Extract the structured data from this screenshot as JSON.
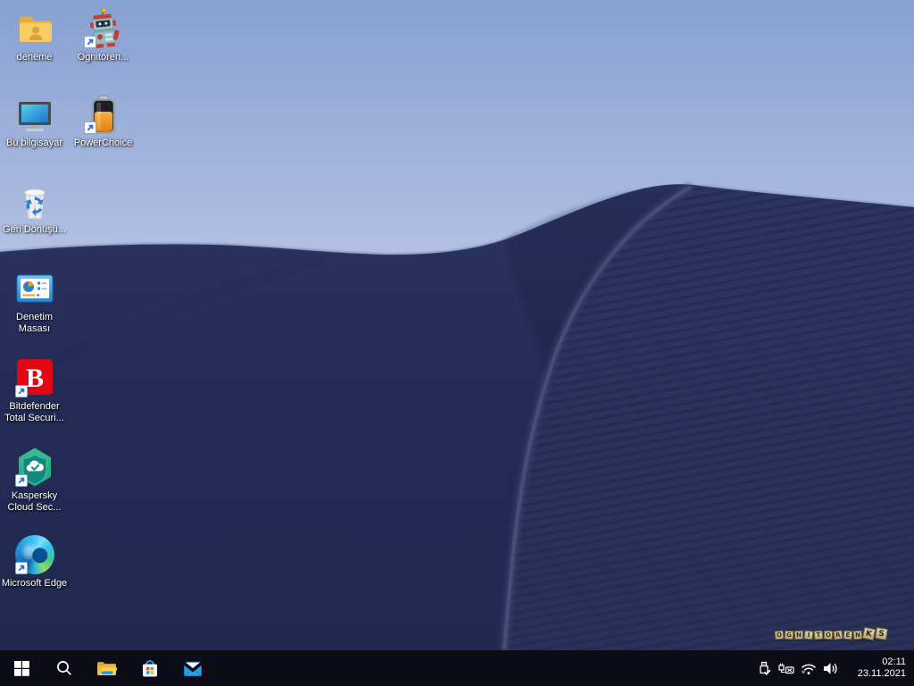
{
  "desktop": {
    "icons": [
      {
        "label": "deneme",
        "icon": "user-folder-icon",
        "shortcut": false
      },
      {
        "label": "Ognitoren...",
        "icon": "robot-toy-icon",
        "shortcut": true
      },
      {
        "label": "Bu bilgisayar",
        "icon": "this-pc-monitor-icon",
        "shortcut": false
      },
      {
        "label": "PowerChoice",
        "icon": "battery-icon",
        "shortcut": true
      },
      {
        "label": "Geri Dönüşü...",
        "icon": "recycle-bin-icon",
        "shortcut": false
      },
      {
        "label": "Denetim Masası",
        "icon": "control-panel-icon",
        "shortcut": false
      },
      {
        "label": "Bitdefender Total Securi...",
        "icon": "bitdefender-icon",
        "shortcut": true
      },
      {
        "label": "Kaspersky Cloud Sec...",
        "icon": "kaspersky-icon",
        "shortcut": true
      },
      {
        "label": "Microsoft Edge",
        "icon": "edge-icon",
        "shortcut": true
      }
    ],
    "watermark_letters": [
      "O",
      "G",
      "N",
      "I",
      "T",
      "O",
      "R",
      "E",
      "N",
      "K",
      "S"
    ]
  },
  "taskbar": {
    "buttons": [
      "start",
      "search",
      "file-explorer",
      "store",
      "mail"
    ],
    "tray": {
      "icons": [
        "usb-safely-remove",
        "ethernet-disconnected",
        "wifi",
        "volume"
      ],
      "time": "02:11",
      "date": "23.11.2021"
    }
  },
  "colors": {
    "taskbar_bg": "#0c0c17",
    "sky_top": "#87a1d3",
    "sky_horizon": "#eef1f7",
    "dune_dark": "#232b52",
    "dune_light_edge": "#565c86"
  }
}
